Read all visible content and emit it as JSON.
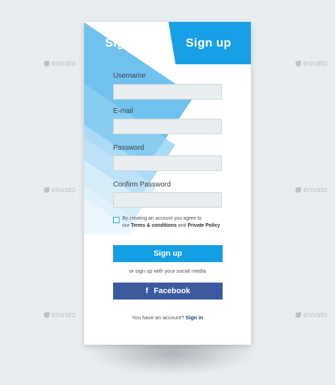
{
  "tabs": {
    "signin": "Sign in",
    "signup": "Sign up"
  },
  "form": {
    "username_label": "Username",
    "email_label": "E-mail",
    "password_label": "Password",
    "confirm_password_label": "Confirm Password",
    "username_value": "",
    "email_value": "",
    "password_value": "",
    "confirm_password_value": ""
  },
  "terms": {
    "line1": "By creating an account you agree to",
    "prefix": "our ",
    "terms_link": "Terms & conditions",
    "and": " and ",
    "privacy_link": "Private Policy",
    "checked": false
  },
  "actions": {
    "signup_button": "Sign up",
    "social_text": "or sign up with your social media",
    "facebook_button": "Facebook",
    "account_text": "You have an account? ",
    "signin_link": "Sign in"
  },
  "watermark": {
    "text": "envato"
  },
  "colors": {
    "accent": "#17a0e6",
    "facebook": "#3c5a9e",
    "background": "#e9edf0",
    "field": "#e9eef1"
  },
  "icons": {
    "facebook": "facebook-icon",
    "watermark": "envato-leaf-icon"
  }
}
